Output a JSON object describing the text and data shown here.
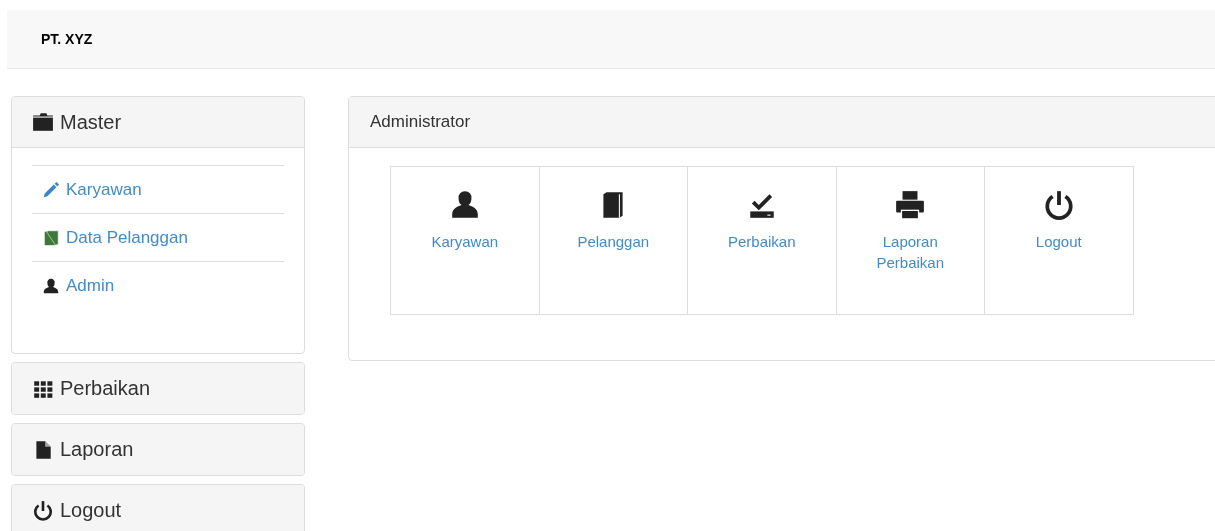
{
  "navbar": {
    "brand": "PT. XYZ"
  },
  "sidebar": {
    "sections": [
      {
        "title": "Master",
        "expanded": true,
        "items": [
          {
            "label": "Karyawan"
          },
          {
            "label": "Data Pelanggan"
          },
          {
            "label": "Admin"
          }
        ]
      },
      {
        "title": "Perbaikan",
        "expanded": false
      },
      {
        "title": "Laporan",
        "expanded": false
      },
      {
        "title": "Logout",
        "expanded": false
      }
    ]
  },
  "main": {
    "title": "Administrator",
    "tiles": [
      {
        "label": "Karyawan"
      },
      {
        "label": "Pelanggan"
      },
      {
        "label": "Perbaikan"
      },
      {
        "label": "Laporan Perbaikan"
      },
      {
        "label": "Logout"
      }
    ]
  }
}
